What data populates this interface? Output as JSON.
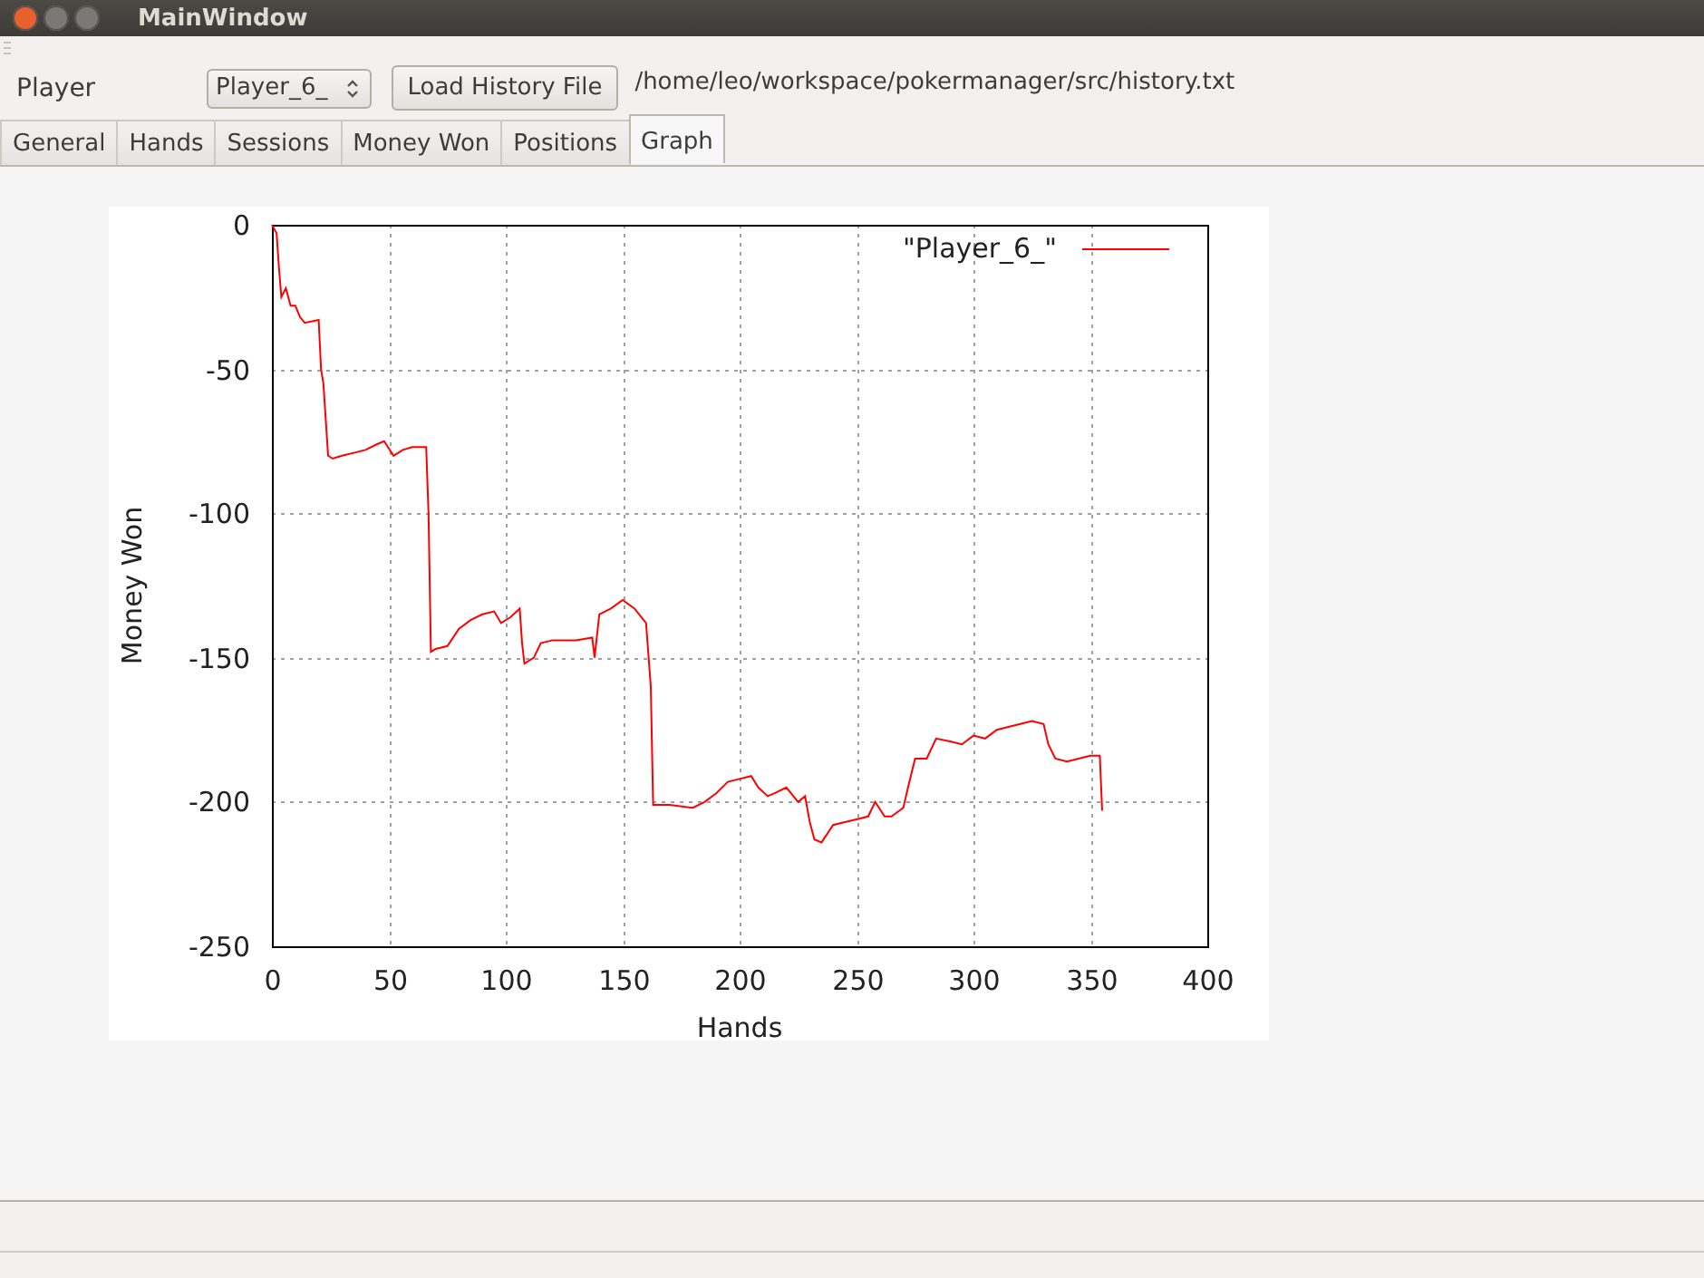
{
  "window": {
    "title": "MainWindow"
  },
  "toolbar": {
    "player_label": "Player",
    "player_select": {
      "value": "Player_6_"
    },
    "load_button": "Load History File",
    "file_path": "/home/leo/workspace/pokermanager/src/history.txt"
  },
  "tabs": [
    {
      "label": "General",
      "selected": false
    },
    {
      "label": "Hands",
      "selected": false
    },
    {
      "label": "Sessions",
      "selected": false
    },
    {
      "label": "Money Won",
      "selected": false
    },
    {
      "label": "Positions",
      "selected": false
    },
    {
      "label": "Graph",
      "selected": true
    }
  ],
  "graph": {
    "chart_data": {
      "type": "line",
      "grid": true,
      "xlabel": "Hands",
      "ylabel": "Money Won",
      "xlim": [
        0,
        400
      ],
      "ylim": [
        -250,
        0
      ],
      "xticks": [
        0,
        50,
        100,
        150,
        200,
        250,
        300,
        350,
        400
      ],
      "yticks": [
        -250,
        -200,
        -150,
        -100,
        -50,
        0
      ],
      "x": [
        0,
        2,
        3,
        4,
        6,
        8,
        10,
        12,
        14,
        20,
        21,
        22,
        24,
        26,
        30,
        35,
        40,
        45,
        48,
        52,
        56,
        60,
        66,
        67,
        68,
        70,
        75,
        80,
        85,
        90,
        95,
        98,
        102,
        106,
        107,
        108,
        112,
        115,
        120,
        130,
        137,
        138,
        140,
        145,
        150,
        155,
        160,
        162,
        163,
        170,
        180,
        185,
        190,
        195,
        200,
        205,
        208,
        212,
        215,
        220,
        225,
        228,
        230,
        232,
        235,
        240,
        245,
        250,
        255,
        258,
        262,
        265,
        270,
        272,
        275,
        280,
        284,
        290,
        295,
        300,
        305,
        310,
        315,
        320,
        325,
        330,
        332,
        335,
        340,
        345,
        350,
        354,
        355
      ],
      "series": [
        {
          "name": "\"Player_6_\"",
          "color": "#ff0000",
          "values": [
            0,
            -3,
            -15,
            -25,
            -22,
            -28,
            -28,
            -32,
            -34,
            -33,
            -50,
            -55,
            -80,
            -81,
            -80,
            -79,
            -78,
            -76,
            -75,
            -80,
            -78,
            -77,
            -77,
            -100,
            -148,
            -147,
            -146,
            -140,
            -137,
            -135,
            -134,
            -138,
            -136,
            -133,
            -145,
            -152,
            -150,
            -145,
            -144,
            -144,
            -143,
            -150,
            -135,
            -133,
            -130,
            -133,
            -138,
            -160,
            -201,
            -201,
            -202,
            -200,
            -197,
            -193,
            -192,
            -191,
            -195,
            -198,
            -197,
            -195,
            -200,
            -198,
            -207,
            -213,
            -214,
            -208,
            -207,
            -206,
            -205,
            -200,
            -205,
            -205,
            -202,
            -195,
            -185,
            -185,
            -178,
            -179,
            -180,
            -177,
            -178,
            -175,
            -174,
            -173,
            -172,
            -173,
            -180,
            -185,
            -186,
            -185,
            -184,
            -184,
            -203
          ]
        }
      ]
    }
  }
}
